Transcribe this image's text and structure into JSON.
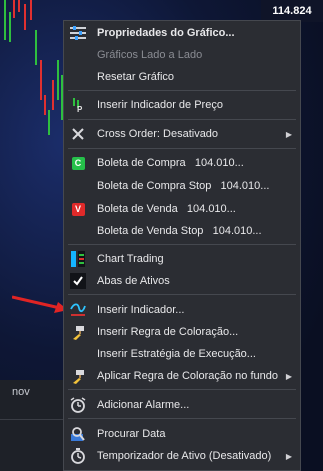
{
  "chart": {
    "price_label": "114.824",
    "time_label": "nov"
  },
  "menu": {
    "items": [
      {
        "label": "Propriedades do Gráfico...",
        "icon": "properties-icon"
      },
      {
        "label": "Gráficos Lado a Lado",
        "icon": "",
        "disabled": true
      },
      {
        "label": "Resetar Gráfico",
        "icon": ""
      },
      {
        "label": "Inserir Indicador de Preço",
        "icon": "price-indicator-icon"
      },
      {
        "label": "Cross Order: Desativado",
        "icon": "cross-order-icon",
        "submenu": true
      },
      {
        "label": "Boleta de Compra   104.010...",
        "icon": "buy-ticket-icon"
      },
      {
        "label": "Boleta de Compra Stop   104.010...",
        "icon": ""
      },
      {
        "label": "Boleta de Venda   104.010...",
        "icon": "sell-ticket-icon"
      },
      {
        "label": "Boleta de Venda Stop   104.010...",
        "icon": ""
      },
      {
        "label": "Chart Trading",
        "icon": "chart-trading-icon"
      },
      {
        "label": "Abas de Ativos",
        "icon": "checkmark-icon"
      },
      {
        "label": "Inserir Indicador...",
        "icon": "insert-indicator-icon"
      },
      {
        "label": "Inserir Regra de Coloração...",
        "icon": "paint-brush-icon"
      },
      {
        "label": "Inserir Estratégia de Execução...",
        "icon": ""
      },
      {
        "label": "Aplicar Regra de Coloração no fundo",
        "icon": "paint-brush-icon",
        "submenu": true
      },
      {
        "label": "Adicionar Alarme...",
        "icon": "alarm-icon"
      },
      {
        "label": "Procurar Data",
        "icon": "search-date-icon"
      },
      {
        "label": "Temporizador de Ativo (Desativado)",
        "icon": "timer-icon",
        "submenu": true
      }
    ],
    "buy_badge": "C",
    "sell_badge": "V",
    "accent_buy": "#25c04a",
    "accent_sell": "#e02a2a"
  }
}
